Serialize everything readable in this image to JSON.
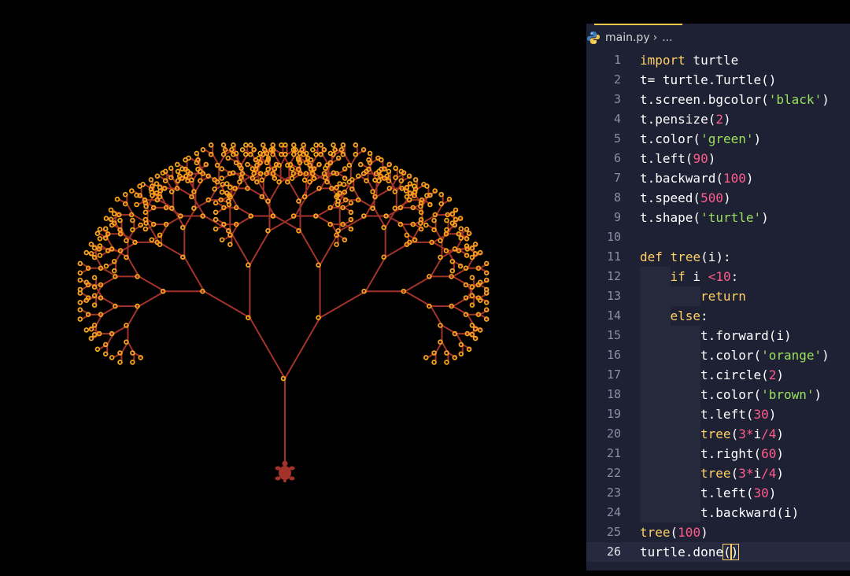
{
  "window": {
    "background": "#000000",
    "editor_background": "#1e2133"
  },
  "turtle_screen": {
    "background_color": "black",
    "tree_color": "brown",
    "tip_color": "orange",
    "turtle_icon": "turtle-icon",
    "tree_size": 100
  },
  "breadcrumb": {
    "icon": "python-icon",
    "file": "main.py",
    "separator": "›",
    "more": "..."
  },
  "code": {
    "lines": [
      {
        "n": "1",
        "indent": 0,
        "tokens": [
          [
            "kw",
            "import"
          ],
          [
            "p",
            " turtle"
          ]
        ]
      },
      {
        "n": "2",
        "indent": 0,
        "tokens": [
          [
            "p",
            "t= turtle.Turtle()"
          ]
        ]
      },
      {
        "n": "3",
        "indent": 0,
        "tokens": [
          [
            "p",
            "t.screen.bgcolor("
          ],
          [
            "str",
            "'black'"
          ],
          [
            "p",
            ")"
          ]
        ]
      },
      {
        "n": "4",
        "indent": 0,
        "tokens": [
          [
            "p",
            "t.pensize("
          ],
          [
            "num",
            "2"
          ],
          [
            "p",
            ")"
          ]
        ]
      },
      {
        "n": "5",
        "indent": 0,
        "tokens": [
          [
            "p",
            "t.color("
          ],
          [
            "str",
            "'green'"
          ],
          [
            "p",
            ")"
          ]
        ]
      },
      {
        "n": "6",
        "indent": 0,
        "tokens": [
          [
            "p",
            "t.left("
          ],
          [
            "num",
            "90"
          ],
          [
            "p",
            ")"
          ]
        ]
      },
      {
        "n": "7",
        "indent": 0,
        "tokens": [
          [
            "p",
            "t.backward("
          ],
          [
            "num",
            "100"
          ],
          [
            "p",
            ")"
          ]
        ]
      },
      {
        "n": "8",
        "indent": 0,
        "tokens": [
          [
            "p",
            "t.speed("
          ],
          [
            "num",
            "500"
          ],
          [
            "p",
            ")"
          ]
        ]
      },
      {
        "n": "9",
        "indent": 0,
        "tokens": [
          [
            "p",
            "t.shape("
          ],
          [
            "str",
            "'turtle'"
          ],
          [
            "p",
            ")"
          ]
        ]
      },
      {
        "n": "10",
        "indent": 0,
        "tokens": []
      },
      {
        "n": "11",
        "indent": 0,
        "tokens": [
          [
            "kw",
            "def"
          ],
          [
            "p",
            " "
          ],
          [
            "fn",
            "tree"
          ],
          [
            "p",
            "(i):"
          ]
        ]
      },
      {
        "n": "12",
        "indent": 1,
        "tokens": [
          [
            "kw",
            "if"
          ],
          [
            "p",
            " i "
          ],
          [
            "op",
            "<"
          ],
          [
            "num",
            "10"
          ],
          [
            "p",
            ":"
          ]
        ]
      },
      {
        "n": "13",
        "indent": 2,
        "tokens": [
          [
            "kw",
            "return"
          ]
        ]
      },
      {
        "n": "14",
        "indent": 1,
        "tokens": [
          [
            "kw",
            "else"
          ],
          [
            "p",
            ":"
          ]
        ]
      },
      {
        "n": "15",
        "indent": 2,
        "tokens": [
          [
            "p",
            "t.forward(i)"
          ]
        ]
      },
      {
        "n": "16",
        "indent": 2,
        "tokens": [
          [
            "p",
            "t.color("
          ],
          [
            "str",
            "'orange'"
          ],
          [
            "p",
            ")"
          ]
        ]
      },
      {
        "n": "17",
        "indent": 2,
        "tokens": [
          [
            "p",
            "t.circle("
          ],
          [
            "num",
            "2"
          ],
          [
            "p",
            ")"
          ]
        ]
      },
      {
        "n": "18",
        "indent": 2,
        "tokens": [
          [
            "p",
            "t.color("
          ],
          [
            "str",
            "'brown'"
          ],
          [
            "p",
            ")"
          ]
        ]
      },
      {
        "n": "19",
        "indent": 2,
        "tokens": [
          [
            "p",
            "t.left("
          ],
          [
            "num",
            "30"
          ],
          [
            "p",
            ")"
          ]
        ]
      },
      {
        "n": "20",
        "indent": 2,
        "tokens": [
          [
            "fn",
            "tree"
          ],
          [
            "p",
            "("
          ],
          [
            "num",
            "3"
          ],
          [
            "op",
            "*"
          ],
          [
            "p",
            "i"
          ],
          [
            "op",
            "/"
          ],
          [
            "num",
            "4"
          ],
          [
            "p",
            ")"
          ]
        ]
      },
      {
        "n": "21",
        "indent": 2,
        "tokens": [
          [
            "p",
            "t.right("
          ],
          [
            "num",
            "60"
          ],
          [
            "p",
            ")"
          ]
        ]
      },
      {
        "n": "22",
        "indent": 2,
        "tokens": [
          [
            "fn",
            "tree"
          ],
          [
            "p",
            "("
          ],
          [
            "num",
            "3"
          ],
          [
            "op",
            "*"
          ],
          [
            "p",
            "i"
          ],
          [
            "op",
            "/"
          ],
          [
            "num",
            "4"
          ],
          [
            "p",
            ")"
          ]
        ]
      },
      {
        "n": "23",
        "indent": 2,
        "tokens": [
          [
            "p",
            "t.left("
          ],
          [
            "num",
            "30"
          ],
          [
            "p",
            ")"
          ]
        ]
      },
      {
        "n": "24",
        "indent": 2,
        "tokens": [
          [
            "p",
            "t.backward(i)"
          ]
        ]
      },
      {
        "n": "25",
        "indent": 0,
        "tokens": [
          [
            "fn",
            "tree"
          ],
          [
            "p",
            "("
          ],
          [
            "num",
            "100"
          ],
          [
            "p",
            ")"
          ]
        ]
      },
      {
        "n": "26",
        "indent": 0,
        "current": true,
        "tokens": [
          [
            "p",
            "turtle.done"
          ],
          [
            "cursorparen",
            "("
          ],
          [
            "cursor",
            ""
          ],
          [
            "cursorparen",
            ")"
          ]
        ]
      }
    ]
  },
  "colors": {
    "keyword": "#ffd166",
    "string": "#9be15d",
    "number": "#ff5c8a",
    "plain": "#ffffff",
    "line_number": "#8a8fa8",
    "branch": "#a3322b",
    "tip": "#f7a21b"
  }
}
